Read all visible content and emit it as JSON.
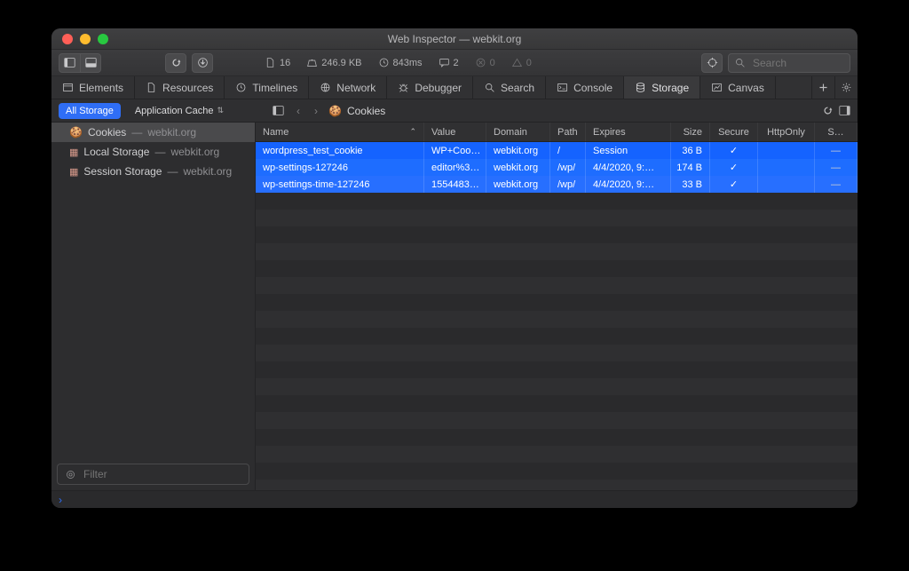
{
  "window": {
    "title": "Web Inspector — webkit.org"
  },
  "metrics": {
    "docs": "16",
    "size": "246.9 KB",
    "time": "843ms",
    "messages": "2",
    "errors": "0",
    "warnings": "0"
  },
  "search": {
    "placeholder": "Search"
  },
  "tabs": [
    {
      "label": "Elements"
    },
    {
      "label": "Resources"
    },
    {
      "label": "Timelines"
    },
    {
      "label": "Network"
    },
    {
      "label": "Debugger"
    },
    {
      "label": "Search"
    },
    {
      "label": "Console"
    },
    {
      "label": "Storage"
    },
    {
      "label": "Canvas"
    }
  ],
  "scope": {
    "all_storage": "All Storage",
    "application_cache": "Application Cache"
  },
  "breadcrumb": {
    "label": "Cookies"
  },
  "sidebar": {
    "items": [
      {
        "label": "Cookies",
        "origin": "webkit.org"
      },
      {
        "label": "Local Storage",
        "origin": "webkit.org"
      },
      {
        "label": "Session Storage",
        "origin": "webkit.org"
      }
    ]
  },
  "filter": {
    "placeholder": "Filter"
  },
  "table": {
    "columns": {
      "name": "Name",
      "value": "Value",
      "domain": "Domain",
      "path": "Path",
      "expires": "Expires",
      "size": "Size",
      "secure": "Secure",
      "httponly": "HttpOnly",
      "samesite": "S…"
    },
    "rows": [
      {
        "name": "wordpress_test_cookie",
        "value": "WP+Coo…",
        "domain": "webkit.org",
        "path": "/",
        "expires": "Session",
        "size": "36 B",
        "secure": true,
        "httponly": false,
        "samesite": "—"
      },
      {
        "name": "wp-settings-127246",
        "value": "editor%3…",
        "domain": "webkit.org",
        "path": "/wp/",
        "expires": "4/4/2020, 9:…",
        "size": "174 B",
        "secure": true,
        "httponly": false,
        "samesite": "—"
      },
      {
        "name": "wp-settings-time-127246",
        "value": "1554483…",
        "domain": "webkit.org",
        "path": "/wp/",
        "expires": "4/4/2020, 9:…",
        "size": "33 B",
        "secure": true,
        "httponly": false,
        "samesite": "—"
      }
    ]
  },
  "console": {
    "prompt": "›"
  }
}
